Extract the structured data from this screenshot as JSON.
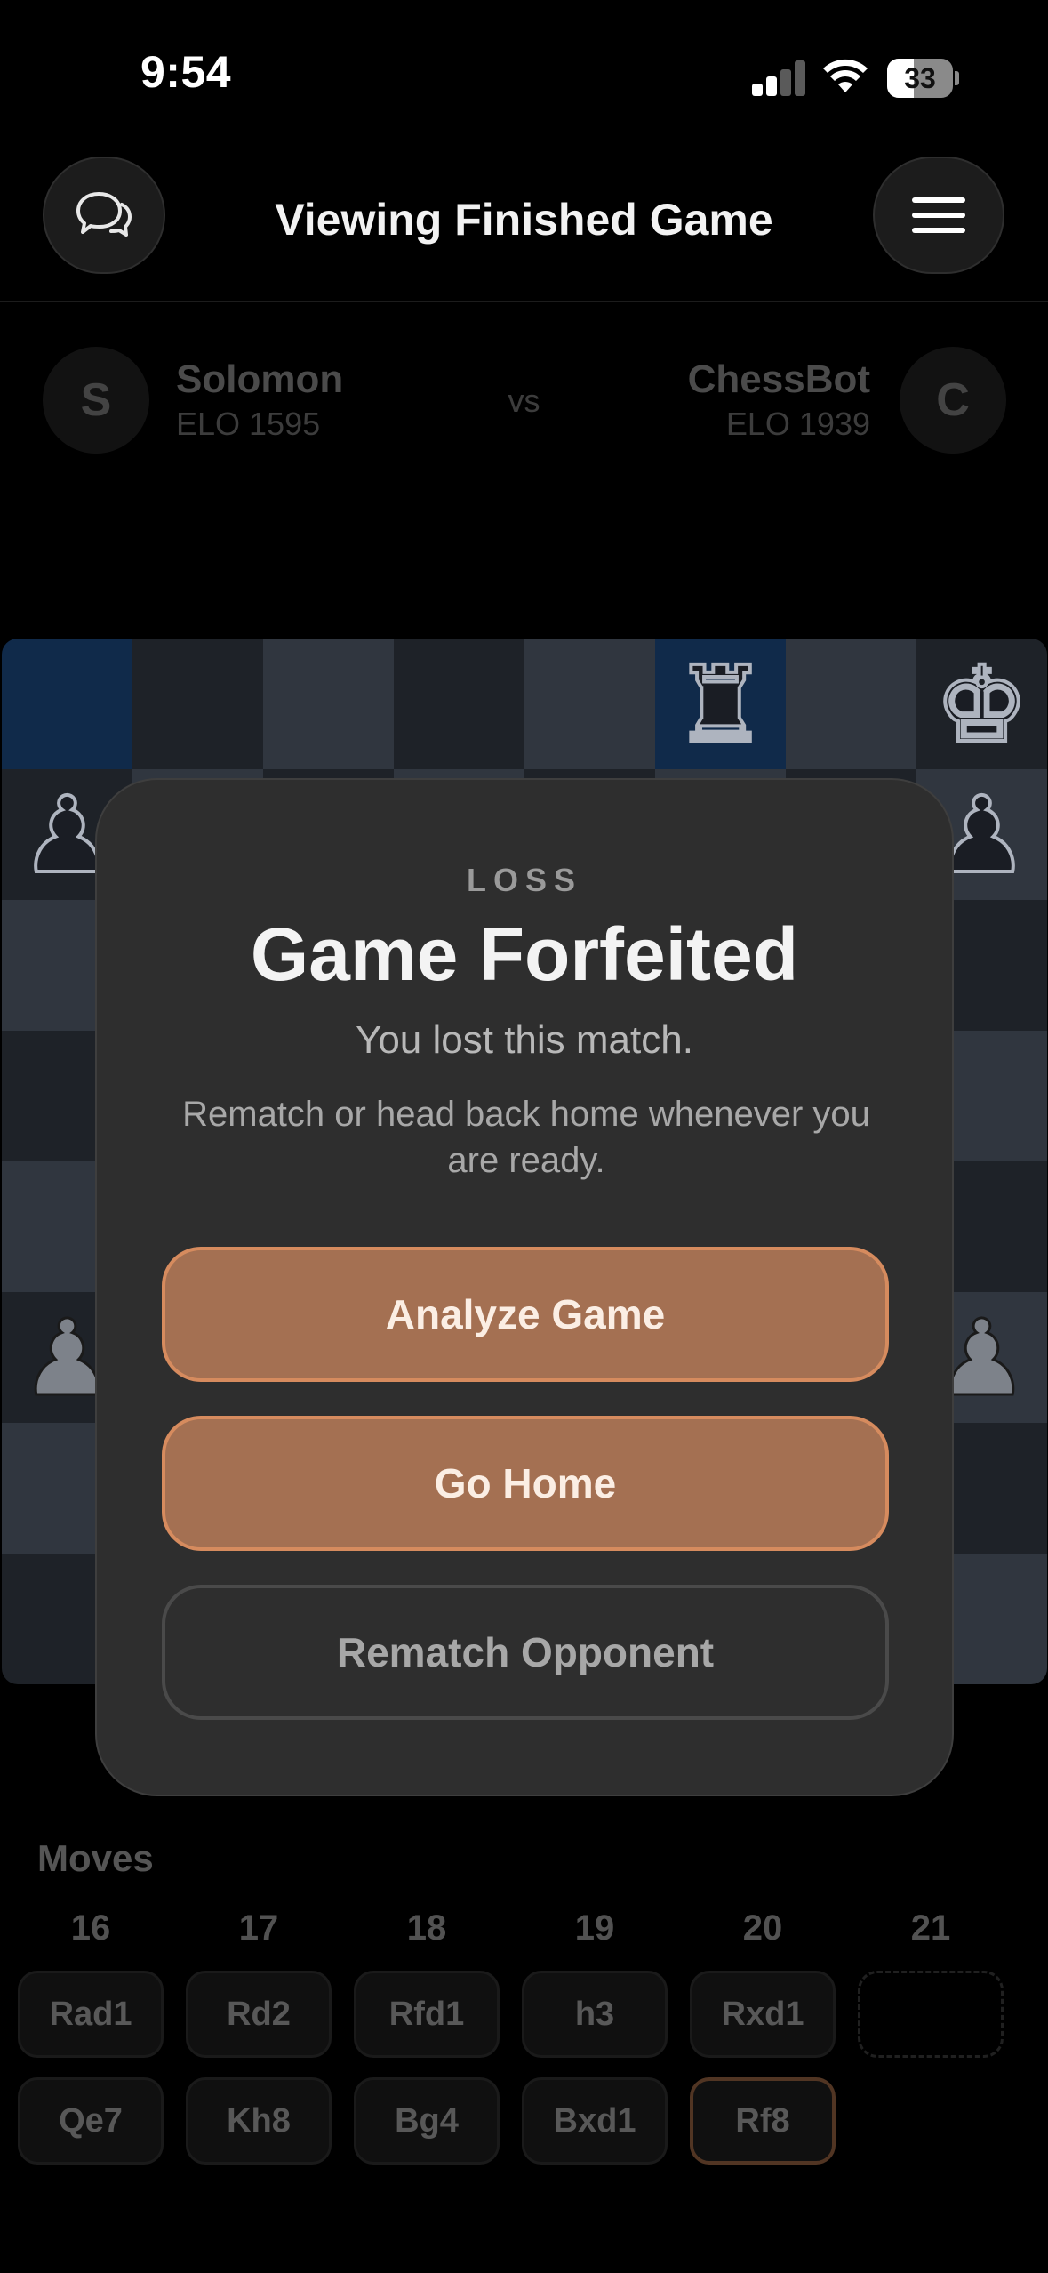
{
  "status_bar": {
    "time": "9:54",
    "battery": "33"
  },
  "header": {
    "title": "Viewing Finished Game",
    "chat_icon": "chat-bubbles-icon",
    "menu_icon": "hamburger-menu-icon"
  },
  "players": {
    "left": {
      "initial": "S",
      "name": "Solomon",
      "elo": "ELO 1595"
    },
    "vs": "vs",
    "right": {
      "initial": "C",
      "name": "ChessBot",
      "elo": "ELO 1939"
    }
  },
  "board": {
    "pieces": [
      {
        "name": "black-rook",
        "glyph": "♜"
      },
      {
        "name": "black-king",
        "glyph": "♚"
      },
      {
        "name": "black-pawn",
        "glyph": "♟"
      },
      {
        "name": "white-pawn",
        "glyph": "♟"
      }
    ]
  },
  "modal": {
    "result": "LOSS",
    "title": "Game Forfeited",
    "subtitle": "You lost this match.",
    "description": "Rematch or head back home whenever you are ready.",
    "buttons": {
      "analyze": "Analyze Game",
      "home": "Go Home",
      "rematch": "Rematch Opponent"
    }
  },
  "moves": {
    "title": "Moves",
    "numbers": [
      "16",
      "17",
      "18",
      "19",
      "20",
      "21"
    ],
    "white": [
      "Rad1",
      "Rd2",
      "Rfd1",
      "h3",
      "Rxd1",
      ""
    ],
    "black": [
      "Qe7",
      "Kh8",
      "Bg4",
      "Bxd1",
      "Rf8"
    ],
    "current": "Rf8"
  },
  "colors": {
    "accent": "#a47052",
    "accent_border": "#d68b5e",
    "modal_bg": "#2e2e2e",
    "board_light": "#30363f",
    "board_dark": "#1e2228",
    "highlight": "#102a4a"
  }
}
